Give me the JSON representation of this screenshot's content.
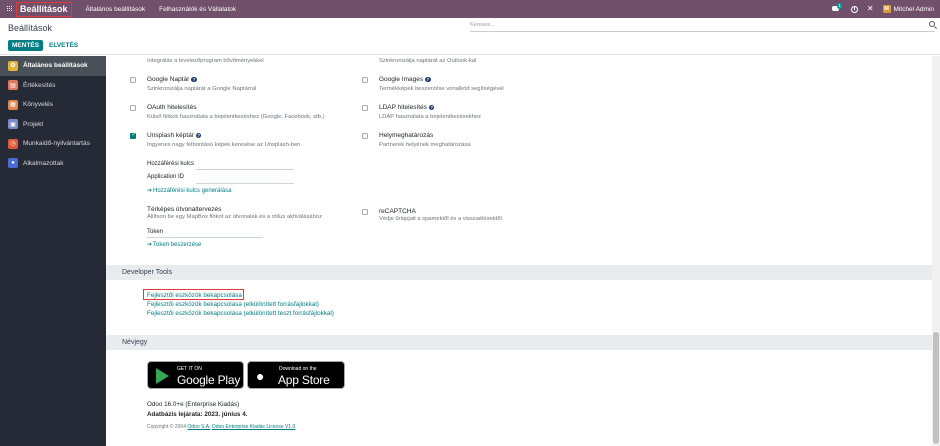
{
  "navbar": {
    "brand": "Beállítások",
    "menu": [
      "Általános beállítások",
      "Felhasználók és Vállalatok"
    ],
    "chat_badge": "1",
    "user_initial": "M",
    "user_name": "Mitchel Admin"
  },
  "control_panel": {
    "title": "Beállítások",
    "search_placeholder": "Keresés...",
    "save_label": "MENTÉS",
    "discard_label": "ELVETÉS"
  },
  "sidebar": {
    "items": [
      {
        "label": "Általános beállítások",
        "icon": "gear-icon",
        "color": "#e2b33c"
      },
      {
        "label": "Értékesítés",
        "icon": "sales-icon",
        "color": "#e07a5f"
      },
      {
        "label": "Könyvelés",
        "icon": "accounting-icon",
        "color": "#e0874f"
      },
      {
        "label": "Projekt",
        "icon": "project-icon",
        "color": "#7a8cc9"
      },
      {
        "label": "Munkaidő-nyilvántartás",
        "icon": "timesheet-icon",
        "color": "#e05a3a"
      },
      {
        "label": "Alkalmazottak",
        "icon": "employees-icon",
        "color": "#4a6bd1"
      }
    ]
  },
  "settings": {
    "top_left_desc": "Integrálás a levelezőprogram bővítményekkel",
    "top_right_desc": "Szinkronizálja naptárát az Outlook-kal",
    "google_calendar": {
      "title": "Google Naptár",
      "desc": "Szinkronizálja naptárát a Google Naptárral"
    },
    "google_images": {
      "title": "Google Images",
      "desc": "Termékképek beszerzése vonalkód segítségével"
    },
    "oauth": {
      "title": "OAuth hitelesítés",
      "desc": "Külső fiókok használata a bejelentkezéshez (Google, Facebook, stb.)"
    },
    "ldap": {
      "title": "LDAP hitelesítés",
      "desc": "LDAP használata a bejelentkezésekhez"
    },
    "unsplash": {
      "title": "Unsplash képtár",
      "desc": "Ingyenes nagy felbontású képek keresése az Unsplash-ben",
      "field1": "Hozzáférési kulcs",
      "field2": "Application ID",
      "link": "Hozzáférési kulcs generálása"
    },
    "geolocation": {
      "title": "Helymeghatározás",
      "desc": "Partnerek helyének meghatározása"
    },
    "route_planning": {
      "title": "Térképes útvonaltervezés",
      "desc": "Állítson be egy MapBox fiókot az útvonalak és a stílus aktiválásához",
      "field": "Token",
      "link": "Token beszerzése"
    },
    "recaptcha": {
      "title": "reCAPTCHA",
      "desc": "Védje űrlapjait a spamektől és a visszaélésektől."
    }
  },
  "developer_tools": {
    "header": "Developer Tools",
    "links": [
      "Fejlesztői eszközök bekapcsolása",
      "Fejlesztői eszközök bekapcsolása (elkülönített forrásfájlokkal)",
      "Fejlesztői eszközök bekapcsolása (elkülönített teszt forrásfájlokkal)"
    ]
  },
  "about": {
    "header": "Névjegy",
    "google_play_small": "GET IT ON",
    "google_play_big": "Google Play",
    "app_store_small": "Download on the",
    "app_store_big": "App Store",
    "version": "Odoo 16.0+e (Enterprise Kiadás)",
    "db_expiry": "Adatbázis lejárata: 2023. június 4.",
    "copyright_prefix": "Copyright © 2004",
    "copyright_link1": "Odoo S.A.",
    "copyright_link2": "Odoo Enterprise Kiadás License V1.0"
  }
}
